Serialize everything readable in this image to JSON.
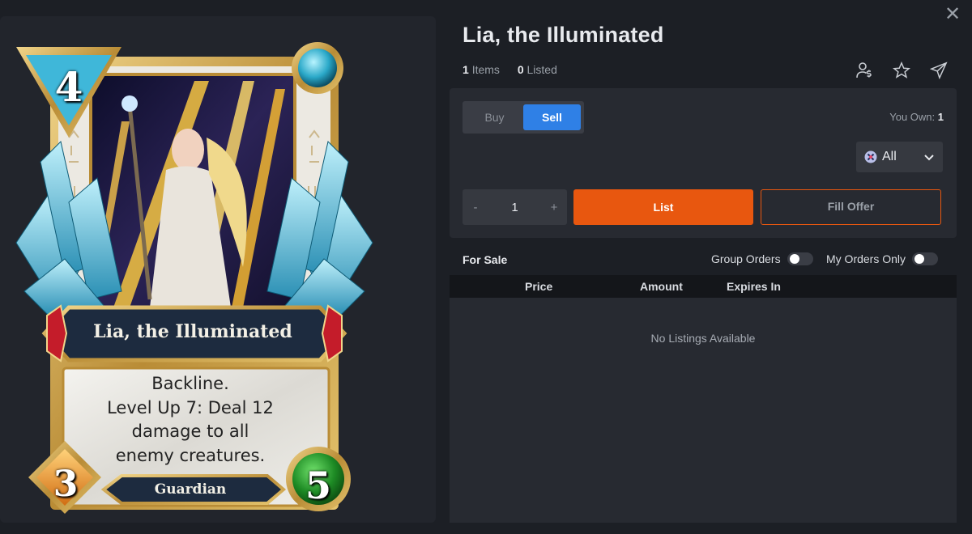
{
  "card": {
    "name": "Lia, the Illuminated",
    "mana": "4",
    "attack": "3",
    "health": "5",
    "ability": "Backline.\nLevel Up 7: Deal 12 damage to all enemy creatures.",
    "ability_lines": [
      "Backline.",
      "Level Up 7: Deal 12",
      "damage to all",
      "enemy creatures."
    ],
    "type": "Guardian",
    "colors": {
      "frame": "#c9a24a",
      "crystal": "#5ac4e0",
      "gem_red": "#c41c2a",
      "health_green": "#2b9a2b",
      "banner": "#1d2b3f"
    }
  },
  "header": {
    "title": "Lia, the Illuminated",
    "items_count": "1",
    "items_label": "Items",
    "listed_count": "0",
    "listed_label": "Listed",
    "icons": [
      "user-price-icon",
      "star-icon",
      "send-icon"
    ],
    "close_label": "✕"
  },
  "trade": {
    "tabs": [
      "Buy",
      "Sell"
    ],
    "active_tab": "Sell",
    "you_own_label": "You Own:",
    "you_own_value": "1",
    "filter_value": "All",
    "quantity": "1",
    "decrement_label": "-",
    "increment_label": "+",
    "list_label": "List",
    "fill_offer_label": "Fill Offer",
    "accent": "#e8570f",
    "active_color": "#2f80e6"
  },
  "listings": {
    "section_title": "For Sale",
    "group_orders_label": "Group Orders",
    "my_orders_label": "My Orders Only",
    "columns": [
      "Price",
      "Amount",
      "Expires In"
    ],
    "empty_text": "No Listings Available"
  }
}
